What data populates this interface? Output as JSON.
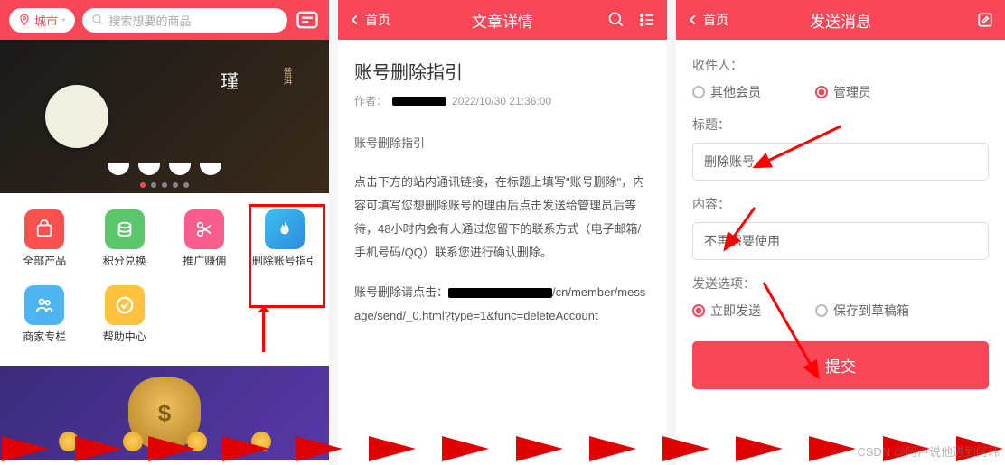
{
  "screen1": {
    "location_label": "城市",
    "search_placeholder": "搜索想要的商品",
    "banner_text": "普洱",
    "grid": [
      {
        "label": "全部产品"
      },
      {
        "label": "积分兑换"
      },
      {
        "label": "推广赚佣"
      },
      {
        "label": "删除账号指引"
      },
      {
        "label": "商家专栏"
      },
      {
        "label": "帮助中心"
      }
    ]
  },
  "screen2": {
    "back_label": "首页",
    "header_title": "文章详情",
    "title": "账号删除指引",
    "author_prefix": "作者：",
    "datetime": "2022/10/30 21:36:00",
    "subheading": "账号删除指引",
    "paragraph": "点击下方的站内通讯链接，在标题上填写\"账号删除\"，内容可填写您想删除账号的理由后点击发送给管理员后等待，48小时内会有人通过您留下的联系方式（电子邮箱/手机号码/QQ）联系您进行确认删除。",
    "link_prefix": "账号删除请点击：",
    "link_suffix": "/cn/member/message/send/_0.html?type=1&func=deleteAccount"
  },
  "screen3": {
    "back_label": "首页",
    "header_title": "发送消息",
    "recipient_label": "收件人：",
    "recipient_options": {
      "other": "其他会员",
      "admin": "管理员"
    },
    "subject_label": "标题：",
    "subject_value": "删除账号",
    "content_label": "内容：",
    "content_value": "不再需要使用",
    "send_options_label": "发送选项：",
    "send_options": {
      "now": "立即发送",
      "draft": "保存到草稿箱"
    },
    "submit_label": "提交"
  },
  "watermark": "CSDN @阿卢说他遇到阿玮"
}
